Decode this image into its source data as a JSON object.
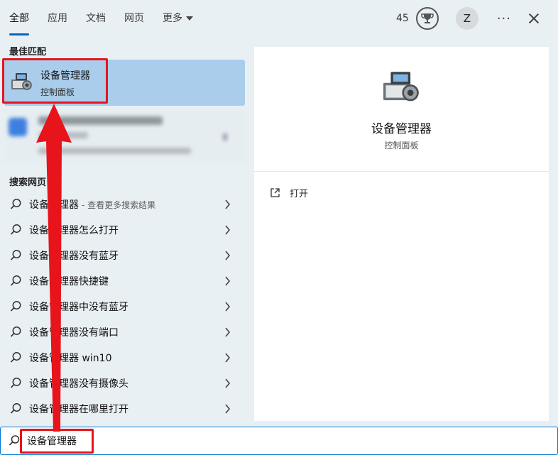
{
  "tabs": [
    {
      "label": "全部"
    },
    {
      "label": "应用"
    },
    {
      "label": "文档"
    },
    {
      "label": "网页"
    },
    {
      "label": "更多"
    }
  ],
  "header": {
    "points": "45",
    "avatar_letter": "Z",
    "more_options": "···"
  },
  "best_match": {
    "section_title": "最佳匹配",
    "title": "设备管理器",
    "subtitle": "控制面板"
  },
  "web_search": {
    "section_title": "搜索网页",
    "items": [
      {
        "label": "设备管理器",
        "hint": "- 查看更多搜索结果"
      },
      {
        "label": "设备管理器怎么打开"
      },
      {
        "label": "设备管理器没有蓝牙"
      },
      {
        "label": "设备管理器快捷键"
      },
      {
        "label": "设备管理器中没有蓝牙"
      },
      {
        "label": "设备管理器没有端口"
      },
      {
        "label": "设备管理器 win10"
      },
      {
        "label": "设备管理器没有摄像头"
      },
      {
        "label": "设备管理器在哪里打开"
      }
    ]
  },
  "detail": {
    "title": "设备管理器",
    "subtitle": "控制面板",
    "open_label": "打开"
  },
  "search": {
    "value": "设备管理器"
  },
  "colors": {
    "accent": "#0067c0",
    "selection": "#a9cdeb",
    "annotation_red": "#e8141b"
  }
}
